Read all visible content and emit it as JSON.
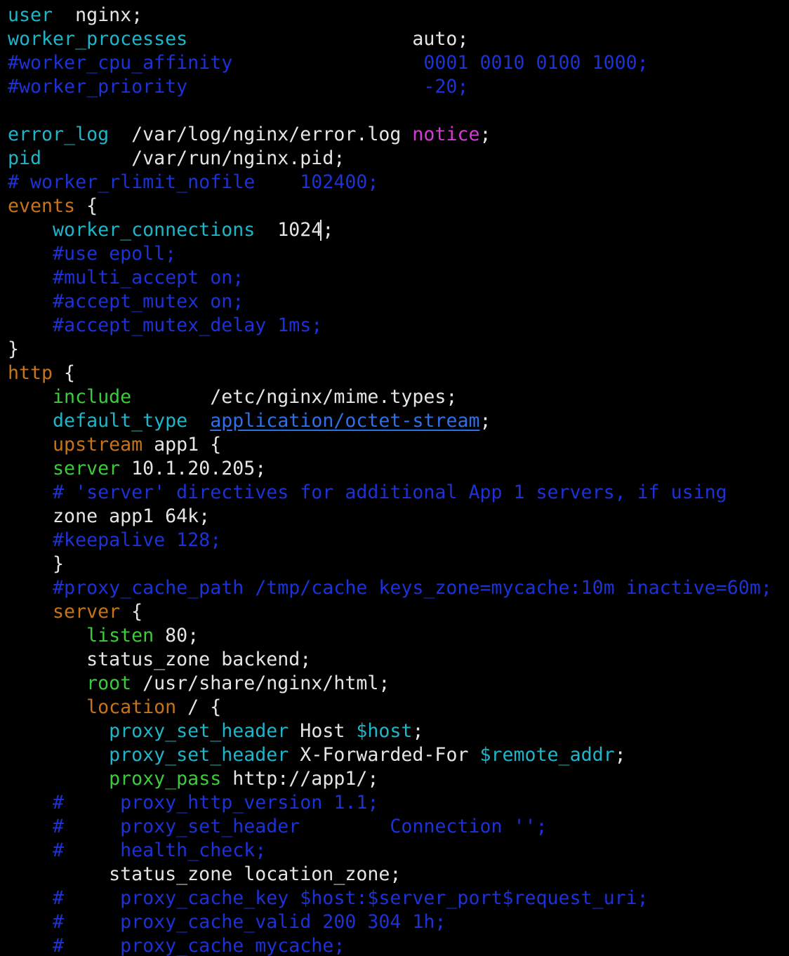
{
  "colors": {
    "background": "#000000",
    "plain": "#e5e5e5",
    "directive": "#1fb5c9",
    "comment": "#1c32d6",
    "block_keyword": "#c6741b",
    "include_keyword": "#3ccb3c",
    "notice": "#d43ad4",
    "variable": "#1fb5c9",
    "link": "#2f6fe8"
  },
  "editor": {
    "lines": [
      [
        {
          "t": "dir",
          "x": "user"
        },
        {
          "t": "plain",
          "x": "  nginx;"
        }
      ],
      [
        {
          "t": "dir",
          "x": "worker_processes"
        },
        {
          "t": "plain",
          "x": "                    auto;"
        }
      ],
      [
        {
          "t": "comment",
          "x": "#worker_cpu_affinity                 0001 0010 0100 1000;"
        }
      ],
      [
        {
          "t": "comment",
          "x": "#worker_priority                     -20;"
        }
      ],
      [],
      [
        {
          "t": "dir",
          "x": "error_log"
        },
        {
          "t": "plain",
          "x": "  /var/log/nginx/error.log "
        },
        {
          "t": "notice",
          "x": "notice"
        },
        {
          "t": "plain",
          "x": ";"
        }
      ],
      [
        {
          "t": "dir",
          "x": "pid"
        },
        {
          "t": "plain",
          "x": "        /var/run/nginx.pid;"
        }
      ],
      [
        {
          "t": "comment",
          "x": "# worker_rlimit_nofile    102400;"
        }
      ],
      [
        {
          "t": "kw",
          "x": "events"
        },
        {
          "t": "plain",
          "x": " {"
        }
      ],
      [
        {
          "t": "plain",
          "x": "    "
        },
        {
          "t": "dir",
          "x": "worker_connections"
        },
        {
          "t": "plain",
          "x": "  1024;"
        }
      ],
      [
        {
          "t": "plain",
          "x": "    "
        },
        {
          "t": "comment",
          "x": "#use epoll;"
        }
      ],
      [
        {
          "t": "plain",
          "x": "    "
        },
        {
          "t": "comment",
          "x": "#multi_accept on;"
        }
      ],
      [
        {
          "t": "plain",
          "x": "    "
        },
        {
          "t": "comment",
          "x": "#accept_mutex on;"
        }
      ],
      [
        {
          "t": "plain",
          "x": "    "
        },
        {
          "t": "comment",
          "x": "#accept_mutex_delay 1ms;"
        }
      ],
      [
        {
          "t": "plain",
          "x": "}"
        }
      ],
      [
        {
          "t": "kw",
          "x": "http"
        },
        {
          "t": "plain",
          "x": " {"
        }
      ],
      [
        {
          "t": "plain",
          "x": "    "
        },
        {
          "t": "inc",
          "x": "include"
        },
        {
          "t": "plain",
          "x": "       /etc/nginx/mime.types;"
        }
      ],
      [
        {
          "t": "plain",
          "x": "    "
        },
        {
          "t": "dir",
          "x": "default_type"
        },
        {
          "t": "plain",
          "x": "  "
        },
        {
          "t": "link",
          "x": "application/octet-stream"
        },
        {
          "t": "plain",
          "x": ";"
        }
      ],
      [
        {
          "t": "plain",
          "x": "    "
        },
        {
          "t": "kw",
          "x": "upstream"
        },
        {
          "t": "plain",
          "x": " app1 {"
        }
      ],
      [
        {
          "t": "plain",
          "x": "    "
        },
        {
          "t": "inc",
          "x": "server"
        },
        {
          "t": "plain",
          "x": " 10.1.20.205;"
        }
      ],
      [
        {
          "t": "plain",
          "x": "    "
        },
        {
          "t": "comment",
          "x": "# 'server' directives for additional App 1 servers, if using"
        }
      ],
      [
        {
          "t": "plain",
          "x": "    zone app1 64k;"
        }
      ],
      [
        {
          "t": "plain",
          "x": "    "
        },
        {
          "t": "comment",
          "x": "#keepalive 128;"
        }
      ],
      [
        {
          "t": "plain",
          "x": "    }"
        }
      ],
      [
        {
          "t": "plain",
          "x": "    "
        },
        {
          "t": "comment",
          "x": "#proxy_cache_path /tmp/cache keys_zone=mycache:10m inactive=60m;"
        }
      ],
      [
        {
          "t": "plain",
          "x": "    "
        },
        {
          "t": "kw",
          "x": "server"
        },
        {
          "t": "plain",
          "x": " {"
        }
      ],
      [
        {
          "t": "plain",
          "x": "       "
        },
        {
          "t": "inc",
          "x": "listen"
        },
        {
          "t": "plain",
          "x": " 80;"
        }
      ],
      [
        {
          "t": "plain",
          "x": "       status_zone backend;"
        }
      ],
      [
        {
          "t": "plain",
          "x": "       "
        },
        {
          "t": "inc",
          "x": "root"
        },
        {
          "t": "plain",
          "x": " /usr/share/nginx/html;"
        }
      ],
      [
        {
          "t": "plain",
          "x": "       "
        },
        {
          "t": "kw",
          "x": "location"
        },
        {
          "t": "plain",
          "x": " / {"
        }
      ],
      [
        {
          "t": "plain",
          "x": "         "
        },
        {
          "t": "dir",
          "x": "proxy_set_header"
        },
        {
          "t": "plain",
          "x": " Host "
        },
        {
          "t": "var",
          "x": "$host"
        },
        {
          "t": "plain",
          "x": ";"
        }
      ],
      [
        {
          "t": "plain",
          "x": "         "
        },
        {
          "t": "dir",
          "x": "proxy_set_header"
        },
        {
          "t": "plain",
          "x": " X-Forwarded-For "
        },
        {
          "t": "var",
          "x": "$remote_addr"
        },
        {
          "t": "plain",
          "x": ";"
        }
      ],
      [
        {
          "t": "plain",
          "x": "         "
        },
        {
          "t": "inc",
          "x": "proxy_pass"
        },
        {
          "t": "plain",
          "x": " http://app1/;"
        }
      ],
      [
        {
          "t": "plain",
          "x": "    "
        },
        {
          "t": "comment",
          "x": "#     proxy_http_version 1.1;"
        }
      ],
      [
        {
          "t": "plain",
          "x": "    "
        },
        {
          "t": "comment",
          "x": "#     proxy_set_header        Connection '';"
        }
      ],
      [
        {
          "t": "plain",
          "x": "    "
        },
        {
          "t": "comment",
          "x": "#     health_check;"
        }
      ],
      [
        {
          "t": "plain",
          "x": "         status_zone location_zone;"
        }
      ],
      [
        {
          "t": "plain",
          "x": "    "
        },
        {
          "t": "comment",
          "x": "#     proxy_cache_key $host:$server_port$request_uri;"
        }
      ],
      [
        {
          "t": "plain",
          "x": "    "
        },
        {
          "t": "comment",
          "x": "#     proxy_cache_valid 200 304 1h;"
        }
      ],
      [
        {
          "t": "plain",
          "x": "    "
        },
        {
          "t": "comment",
          "x": "#     proxy_cache mycache;"
        }
      ]
    ]
  }
}
